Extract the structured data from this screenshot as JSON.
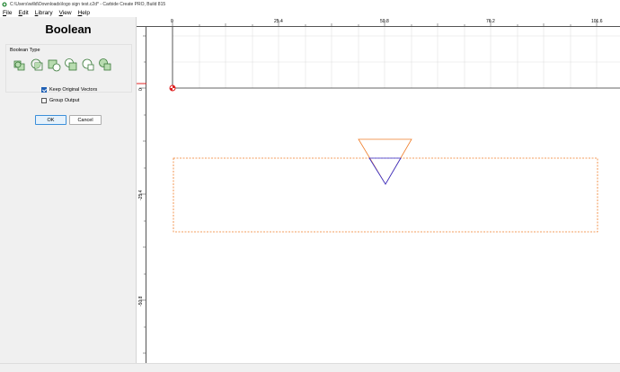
{
  "window": {
    "title": "C:\\Users\\willd\\Downloads\\logo sign test.c2d* - Carbide Create PRO, Build 815"
  },
  "menu": [
    "File",
    "Edit",
    "Library",
    "View",
    "Help"
  ],
  "panel": {
    "title": "Boolean",
    "boolean_type_label": "Boolean Type",
    "boolean_icons": [
      "union-icon",
      "intersect-icon",
      "subtract-icon",
      "subtract-reverse-icon",
      "xor-icon",
      "combine-icon"
    ],
    "keep_original_label": "Keep Original Vectors",
    "keep_original_checked": true,
    "group_output_label": "Group Output",
    "group_output_checked": false,
    "ok_label": "OK",
    "cancel_label": "Cancel"
  },
  "rulers": {
    "top_ticks": [
      "0",
      "25.4",
      "50.8",
      "76.2",
      "101.6"
    ],
    "left_ticks": [
      "0",
      "-25.4",
      "-50.8"
    ]
  },
  "colors": {
    "selected_outline": "#f07d28",
    "vector": "#2b2bd6",
    "grid": "#e0e0e0",
    "origin": "#e02020",
    "accent": "#1e5fb4"
  }
}
